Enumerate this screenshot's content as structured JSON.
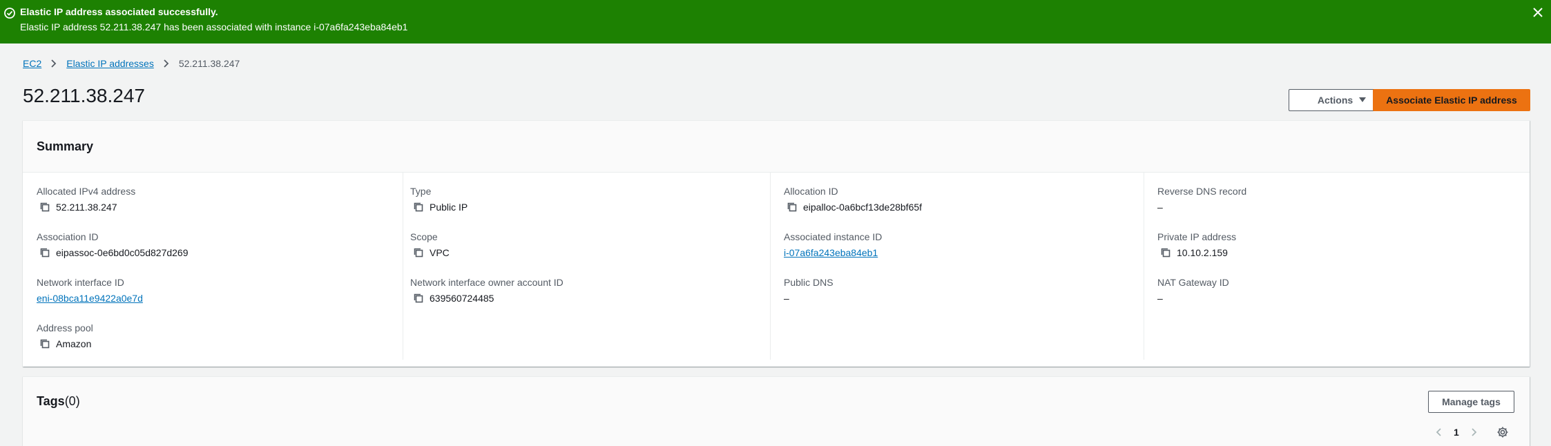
{
  "flash": {
    "title": "Elastic IP address associated successfully.",
    "message": "Elastic IP address 52.211.38.247 has been associated with instance i-07a6fa243eba84eb1",
    "color": "#1d8102"
  },
  "breadcrumb": {
    "items": [
      "EC2",
      "Elastic IP addresses"
    ],
    "current": "52.211.38.247"
  },
  "page": {
    "title": "52.211.38.247",
    "actions_label": "Actions",
    "primary_label": "Associate Elastic IP address",
    "primary_color": "#ec7211"
  },
  "summary": {
    "title": "Summary",
    "allocated_ipv4": {
      "label": "Allocated IPv4 address",
      "value": "52.211.38.247"
    },
    "association_id": {
      "label": "Association ID",
      "value": "eipassoc-0e6bd0c05d827d269"
    },
    "network_interface_id": {
      "label": "Network interface ID",
      "value": "eni-08bca11e9422a0e7d"
    },
    "address_pool": {
      "label": "Address pool",
      "value": "Amazon"
    },
    "type": {
      "label": "Type",
      "value": "Public IP"
    },
    "scope": {
      "label": "Scope",
      "value": "VPC"
    },
    "ni_owner": {
      "label": "Network interface owner account ID",
      "value": "639560724485"
    },
    "allocation_id": {
      "label": "Allocation ID",
      "value": "eipalloc-0a6bcf13de28bf65f"
    },
    "associated_instance": {
      "label": "Associated instance ID",
      "value": "i-07a6fa243eba84eb1"
    },
    "public_dns": {
      "label": "Public DNS",
      "value": "–"
    },
    "reverse_dns": {
      "label": "Reverse DNS record",
      "value": "–"
    },
    "private_ip": {
      "label": "Private IP address",
      "value": "10.10.2.159"
    },
    "nat_gateway": {
      "label": "NAT Gateway ID",
      "value": "–"
    }
  },
  "tags": {
    "title": "Tags",
    "count": "(0)",
    "manage_label": "Manage tags",
    "page": "1"
  },
  "link_color": "#0073bb"
}
